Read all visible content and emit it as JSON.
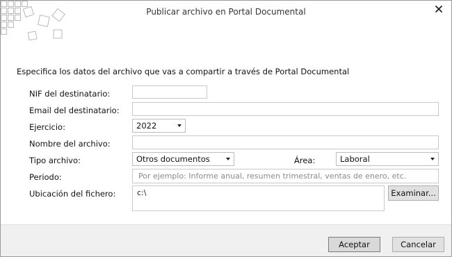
{
  "window": {
    "title": "Publicar archivo en Portal Documental"
  },
  "intro": "Especifica los datos del archivo que vas a compartir a través de Portal Documental",
  "form": {
    "nif_label": "NIF del destinatario:",
    "nif_value": "",
    "email_label": "Email del destinatario:",
    "email_value": "",
    "ejercicio_label": "Ejercicio:",
    "ejercicio_value": "2022",
    "nombre_label": "Nombre del archivo:",
    "nombre_value": "",
    "tipo_label": "Tipo archivo:",
    "tipo_value": "Otros documentos",
    "area_label": "Área:",
    "area_value": "Laboral",
    "periodo_label": "Periodo:",
    "periodo_placeholder": "Por ejemplo: Informe anual, resumen trimestral, ventas de enero, etc.",
    "ubicacion_label": "Ubicación del fichero:",
    "ubicacion_value": "c:\\",
    "examinar_label": "Examinar..."
  },
  "buttons": {
    "accept": "Aceptar",
    "cancel": "Cancelar"
  },
  "icons": {
    "close": "close-icon",
    "logo": "logo-squares-icon",
    "dropdown": "chevron-down-icon"
  }
}
